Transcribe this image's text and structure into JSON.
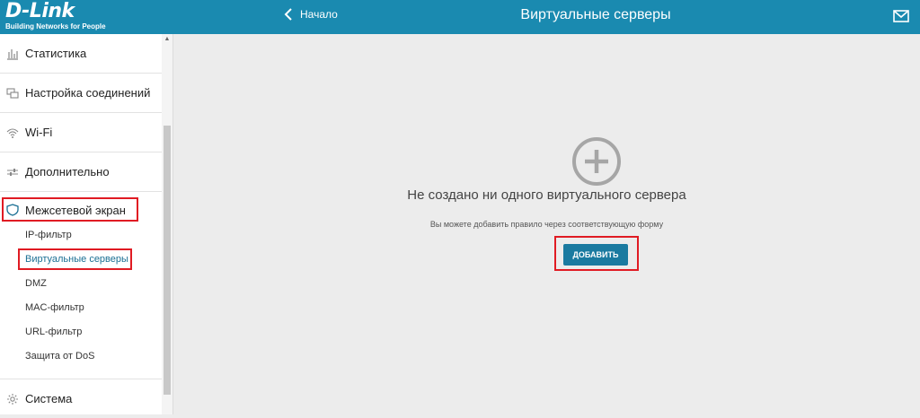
{
  "header": {
    "logo_text": "D-Link",
    "logo_tagline": "Building Networks for People",
    "back_label": "Начало",
    "title": "Виртуальные серверы"
  },
  "sidebar": {
    "items": [
      {
        "label": "Статистика",
        "icon": "stats-icon"
      },
      {
        "label": "Настройка соединений",
        "icon": "connections-icon"
      },
      {
        "label": "Wi-Fi",
        "icon": "wifi-icon"
      },
      {
        "label": "Дополнительно",
        "icon": "sliders-icon"
      },
      {
        "label": "Межсетевой экран",
        "icon": "shield-icon"
      },
      {
        "label": "Система",
        "icon": "gear-icon"
      }
    ],
    "subitems": [
      {
        "label": "IP-фильтр"
      },
      {
        "label": "Виртуальные серверы",
        "active": true
      },
      {
        "label": "DMZ"
      },
      {
        "label": "MAC-фильтр"
      },
      {
        "label": "URL-фильтр"
      },
      {
        "label": "Защита от DoS"
      }
    ]
  },
  "main": {
    "empty_title": "Не создано ни одного виртуального сервера",
    "empty_subtitle": "Вы можете добавить правило через соответствующую форму",
    "add_button": "ДОБАВИТЬ"
  },
  "colors": {
    "header": "#1a8ab0",
    "button": "#1a7aa0",
    "highlight": "#e01b23",
    "active_subitem": "#1a6f93"
  }
}
